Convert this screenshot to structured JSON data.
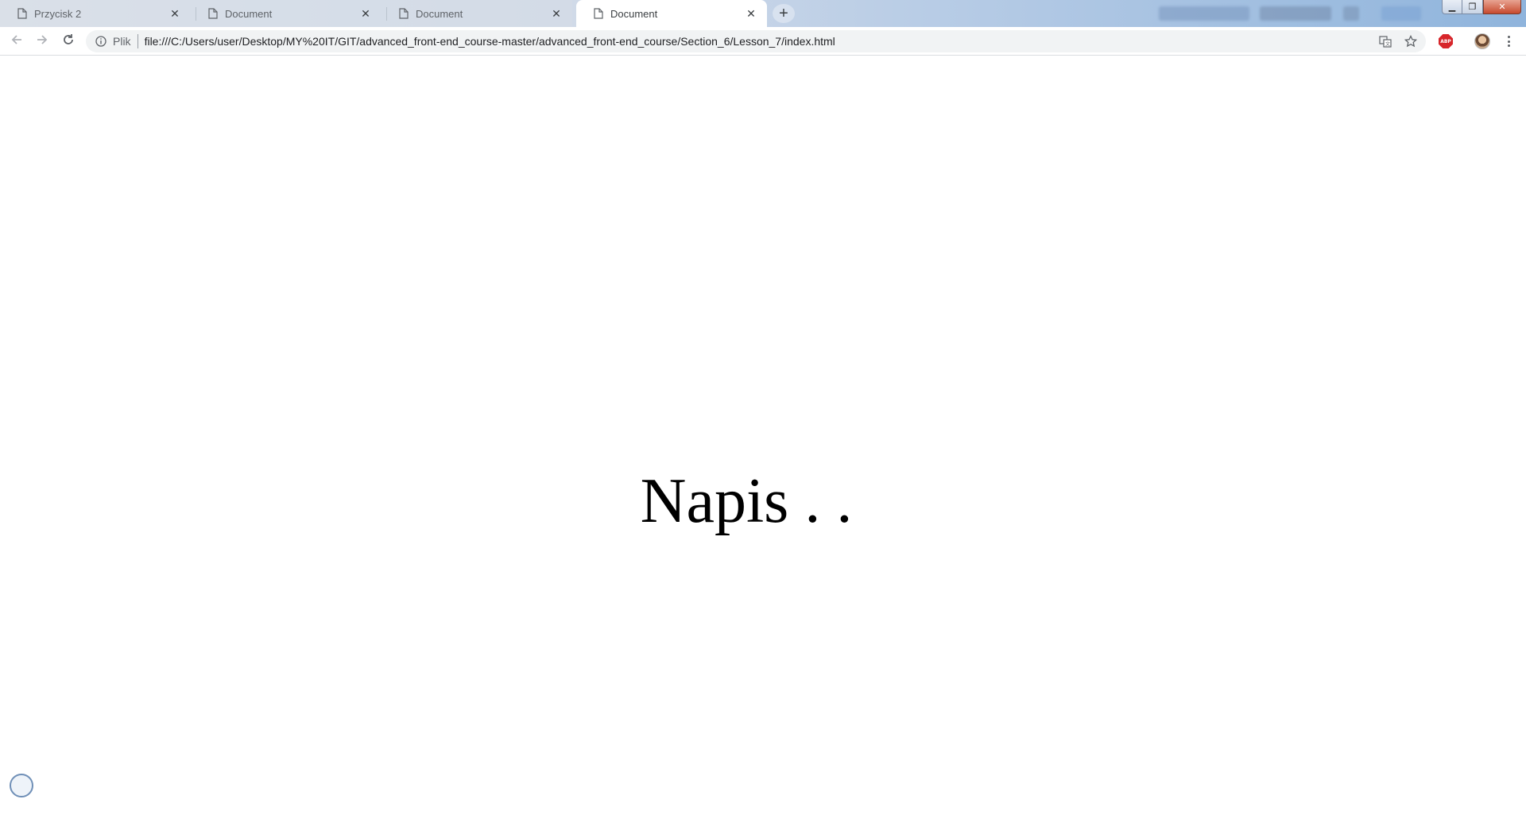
{
  "browser": {
    "tabs": [
      {
        "title": "Przycisk 2",
        "active": false
      },
      {
        "title": "Document",
        "active": false
      },
      {
        "title": "Document",
        "active": false
      },
      {
        "title": "Document",
        "active": true
      }
    ],
    "omnibox": {
      "security_label": "Plik",
      "url": "file:///C:/Users/user/Desktop/MY%20IT/GIT/advanced_front-end_course-master/advanced_front-end_course/Section_6/Lesson_7/index.html"
    },
    "extension_abp_label": "ABP"
  },
  "page": {
    "headline": "Napis . ."
  },
  "icons": {
    "back": "arrow-back-icon",
    "forward": "arrow-forward-icon",
    "reload": "reload-icon",
    "info": "info-icon",
    "translate": "translate-icon",
    "bookmark": "star-icon",
    "menu": "kebab-menu-icon"
  },
  "colors": {
    "abp_red": "#d7262b",
    "omnibox_bg": "#f1f3f4",
    "tabstrip_blue": "#8fb4dc"
  }
}
